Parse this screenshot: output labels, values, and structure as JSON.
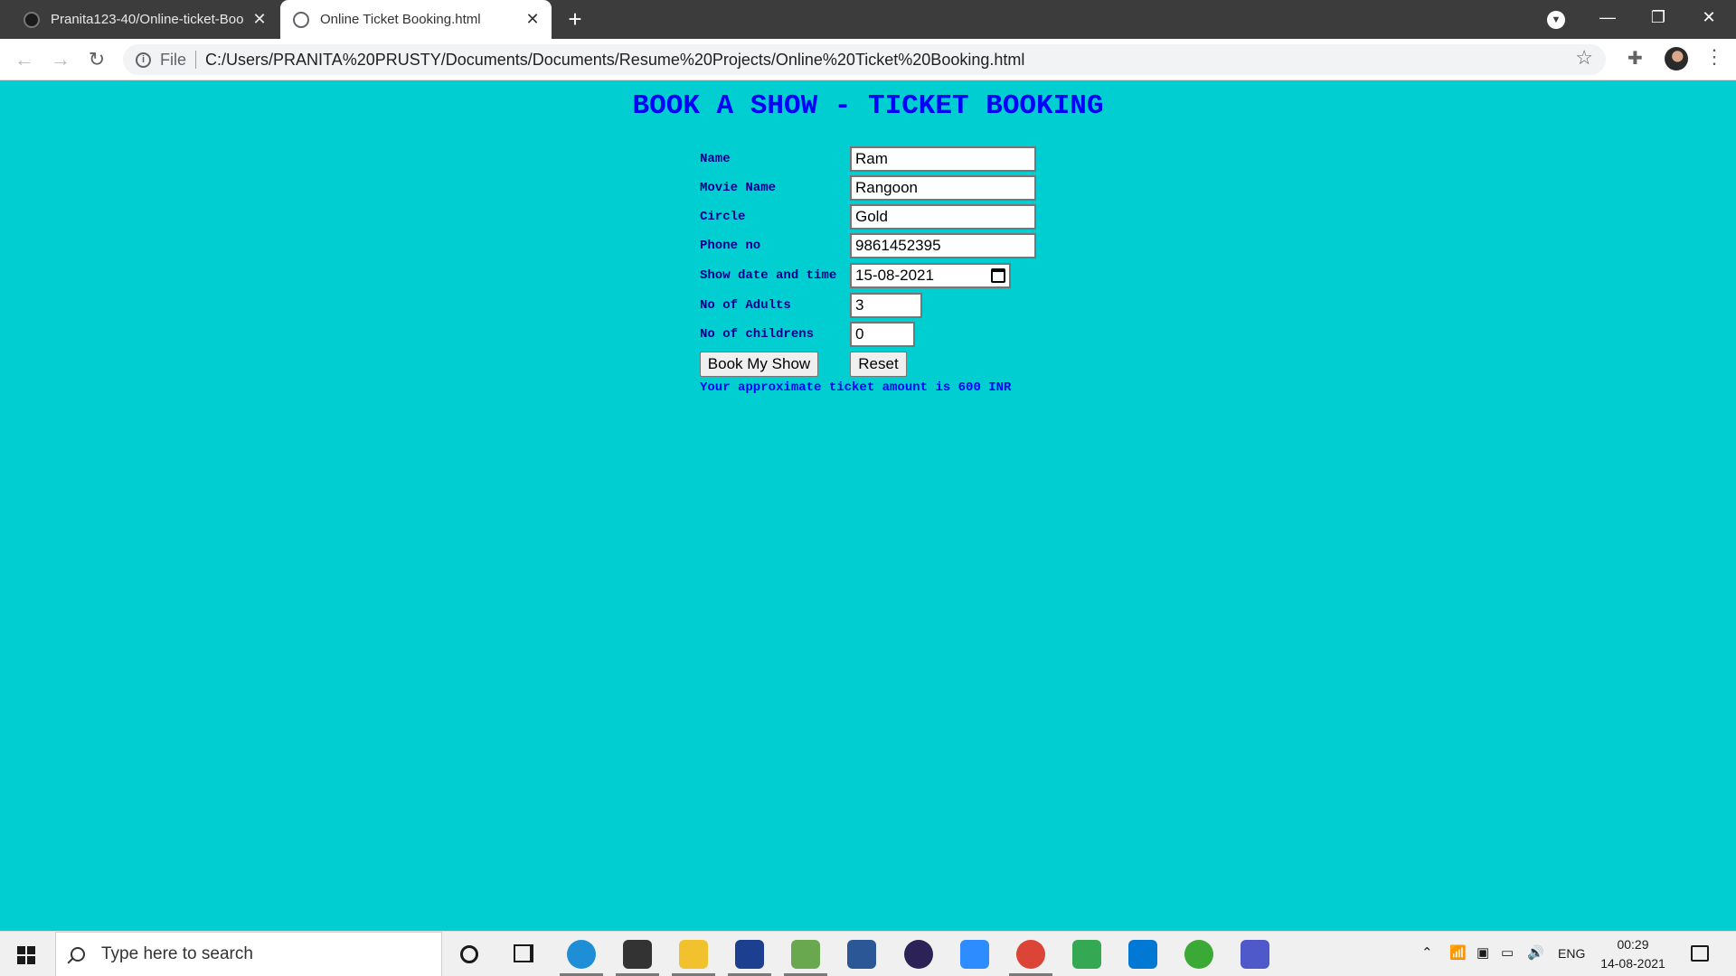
{
  "browser": {
    "tabs": [
      {
        "title": "Pranita123-40/Online-ticket-Boo",
        "close": "✕"
      },
      {
        "title": "Online Ticket Booking.html",
        "close": "✕"
      }
    ],
    "new_tab": "+",
    "address": {
      "scheme_label": "File",
      "url": "C:/Users/PRANITA%20PRUSTY/Documents/Documents/Resume%20Projects/Online%20Ticket%20Booking.html"
    },
    "window_controls": {
      "minimize": "—",
      "restore": "❐",
      "close": "✕"
    }
  },
  "page": {
    "title": "BOOK A SHOW - TICKET BOOKING",
    "fields": {
      "name": {
        "label": "Name",
        "value": "Ram"
      },
      "movie": {
        "label": "Movie Name",
        "value": "Rangoon"
      },
      "circle": {
        "label": "Circle",
        "value": "Gold"
      },
      "phone": {
        "label": "Phone no",
        "value": "9861452395"
      },
      "show_date": {
        "label": "Show date and time",
        "value": "15-08-2021"
      },
      "adults": {
        "label": "No of Adults",
        "value": "3"
      },
      "children": {
        "label": "No of childrens",
        "value": "0"
      }
    },
    "buttons": {
      "book": "Book My Show",
      "reset": "Reset"
    },
    "amount_text": "Your approximate ticket amount is 600 INR"
  },
  "taskbar": {
    "search_placeholder": "Type here to search",
    "language": "ENG",
    "time": "00:29",
    "date": "14-08-2021",
    "apps": [
      {
        "name": "edge-icon",
        "color": "#1e8fd6"
      },
      {
        "name": "store-icon",
        "color": "#333333"
      },
      {
        "name": "file-explorer-icon",
        "color": "#f2c12e"
      },
      {
        "name": "devc-icon",
        "color": "#1c3f8f"
      },
      {
        "name": "paint-icon",
        "color": "#6aa84f"
      },
      {
        "name": "word-icon",
        "color": "#2b5797"
      },
      {
        "name": "eclipse-icon",
        "color": "#2c2255"
      },
      {
        "name": "zoom-icon",
        "color": "#2d8cff"
      },
      {
        "name": "chrome-icon",
        "color": "#db4437"
      },
      {
        "name": "maps-icon",
        "color": "#34a853"
      },
      {
        "name": "vscode-icon",
        "color": "#0078d4"
      },
      {
        "name": "refresh-ring-icon",
        "color": "#3aa935"
      },
      {
        "name": "teams-icon",
        "color": "#5059c9"
      }
    ]
  }
}
